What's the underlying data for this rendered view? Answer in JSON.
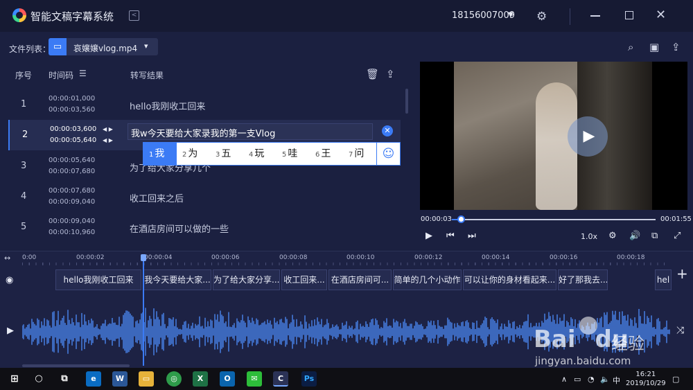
{
  "app": {
    "title": "智能文稿字幕系统",
    "account": "18156007009"
  },
  "file_bar": {
    "label": "文件列表：",
    "file_name": "哀嬢嬢vlog.mp4"
  },
  "table": {
    "headers": {
      "seq": "序号",
      "timecode": "时间码",
      "result": "转写结果"
    },
    "rows": [
      {
        "seq": "1",
        "start": "00:00:01,000",
        "end": "00:00:03,560",
        "text": "hello我刚收工回来"
      },
      {
        "seq": "2",
        "start": "00:00:03,600",
        "end": "00:00:05,640",
        "text": "我w今天要给大家录我的第一支Vlog"
      },
      {
        "seq": "3",
        "start": "00:00:05,640",
        "end": "00:00:07,680",
        "text": "为了给大家分享几个"
      },
      {
        "seq": "4",
        "start": "00:00:07,680",
        "end": "00:00:09,040",
        "text": "收工回来之后"
      },
      {
        "seq": "5",
        "start": "00:00:09,040",
        "end": "00:00:10,960",
        "text": "在酒店房间可以做的一些"
      }
    ]
  },
  "ime": {
    "candidates": [
      {
        "num": "1",
        "char": "我"
      },
      {
        "num": "2",
        "char": "为"
      },
      {
        "num": "3",
        "char": "五"
      },
      {
        "num": "4",
        "char": "玩"
      },
      {
        "num": "5",
        "char": "哇"
      },
      {
        "num": "6",
        "char": "王"
      },
      {
        "num": "7",
        "char": "问"
      }
    ]
  },
  "player": {
    "current_time": "00:00:03",
    "total_time": "00:01:55",
    "progress": 0.03,
    "speed": "1.0x"
  },
  "timeline": {
    "ticks": [
      "0:00",
      "00:00:02",
      "00:00:04",
      "00:00:06",
      "00:00:08",
      "00:00:10",
      "00:00:12",
      "00:00:14",
      "00:00:16",
      "00:00:18"
    ],
    "subtitles": [
      "hello我刚收工回来",
      "我今天要给大家...",
      "为了给大家分享...",
      "收工回来...",
      "在酒店房间可...",
      "简单的几个小动作",
      "可以让你的身材看起来...",
      "好了那我去...",
      "hel"
    ]
  },
  "watermark": {
    "logo": "Bai",
    "logo2": "du",
    "cn": "经验",
    "url": "jingyan.baidu.com"
  },
  "taskbar": {
    "ime_indicator": "中",
    "time": "16:21",
    "date": "2019/10/29"
  },
  "colors": {
    "accent": "#3b7bf5",
    "background": "#1b2040",
    "waveform": "#4a86f0"
  }
}
